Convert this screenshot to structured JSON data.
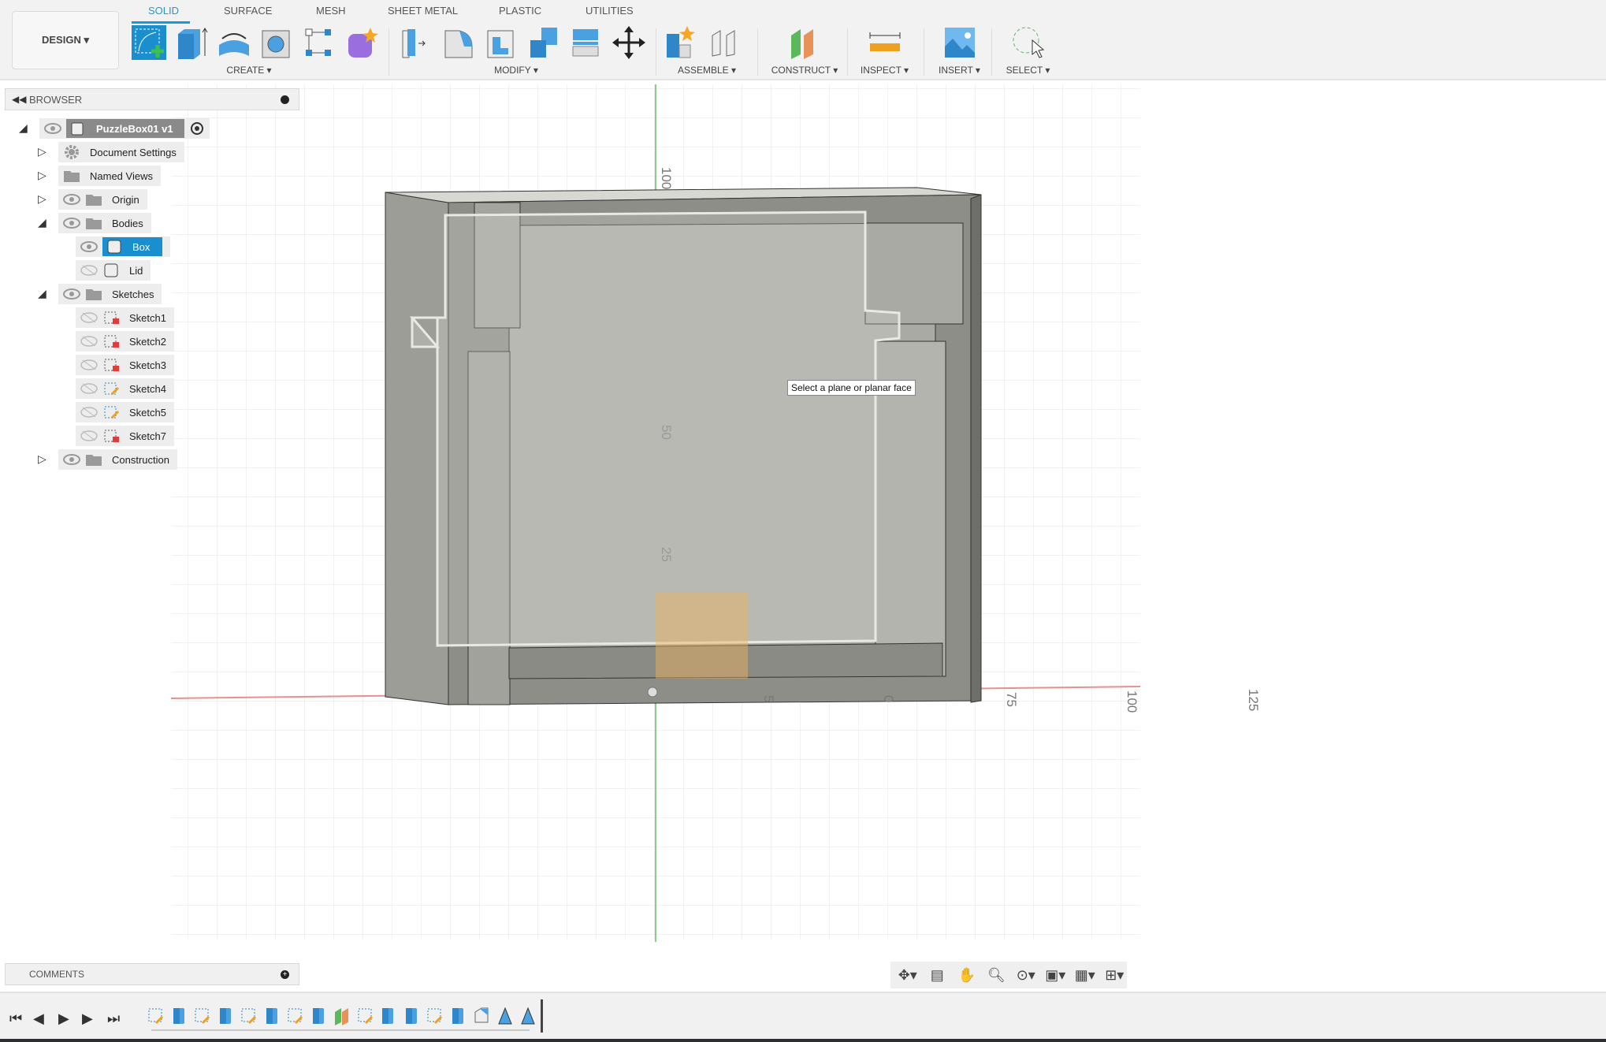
{
  "toolbar": {
    "workspace": "DESIGN ▾",
    "tabs": [
      "SOLID",
      "SURFACE",
      "MESH",
      "SHEET METAL",
      "PLASTIC",
      "UTILITIES"
    ],
    "active_tab": "SOLID",
    "groups": {
      "create": "CREATE ▾",
      "modify": "MODIFY ▾",
      "assemble": "ASSEMBLE ▾",
      "construct": "CONSTRUCT ▾",
      "inspect": "INSPECT ▾",
      "insert": "INSERT ▾",
      "select": "SELECT ▾"
    }
  },
  "browser": {
    "title": "BROWSER",
    "root": "PuzzleBox01 v1",
    "items": [
      {
        "label": "Document Settings"
      },
      {
        "label": "Named Views"
      },
      {
        "label": "Origin"
      },
      {
        "label": "Bodies"
      },
      {
        "label": "Box"
      },
      {
        "label": "Lid"
      },
      {
        "label": "Sketches"
      },
      {
        "label": "Sketch1"
      },
      {
        "label": "Sketch2"
      },
      {
        "label": "Sketch3"
      },
      {
        "label": "Sketch4"
      },
      {
        "label": "Sketch5"
      },
      {
        "label": "Sketch7"
      },
      {
        "label": "Construction"
      }
    ]
  },
  "viewport": {
    "tooltip": "Select a plane or planar face",
    "axis_labels": {
      "y_top": "100",
      "y_mid": "50",
      "y_low": "25",
      "x1": "5",
      "x2": "0",
      "x3": "75",
      "x4": "100",
      "x5": "125"
    }
  },
  "comments": {
    "title": "COMMENTS"
  },
  "colors": {
    "accent": "#1a9ad6",
    "x_axis": "#e06060",
    "y_axis": "#70c070",
    "body": "#9c9c96"
  },
  "timeline": {
    "features": [
      "sketch",
      "extrude",
      "sketch",
      "extrude",
      "sketch",
      "extrude",
      "sketch",
      "extrude",
      "plane",
      "sketch",
      "extrude",
      "extrude",
      "sketch",
      "extrude",
      "shell",
      "mirror",
      "mirror"
    ]
  }
}
